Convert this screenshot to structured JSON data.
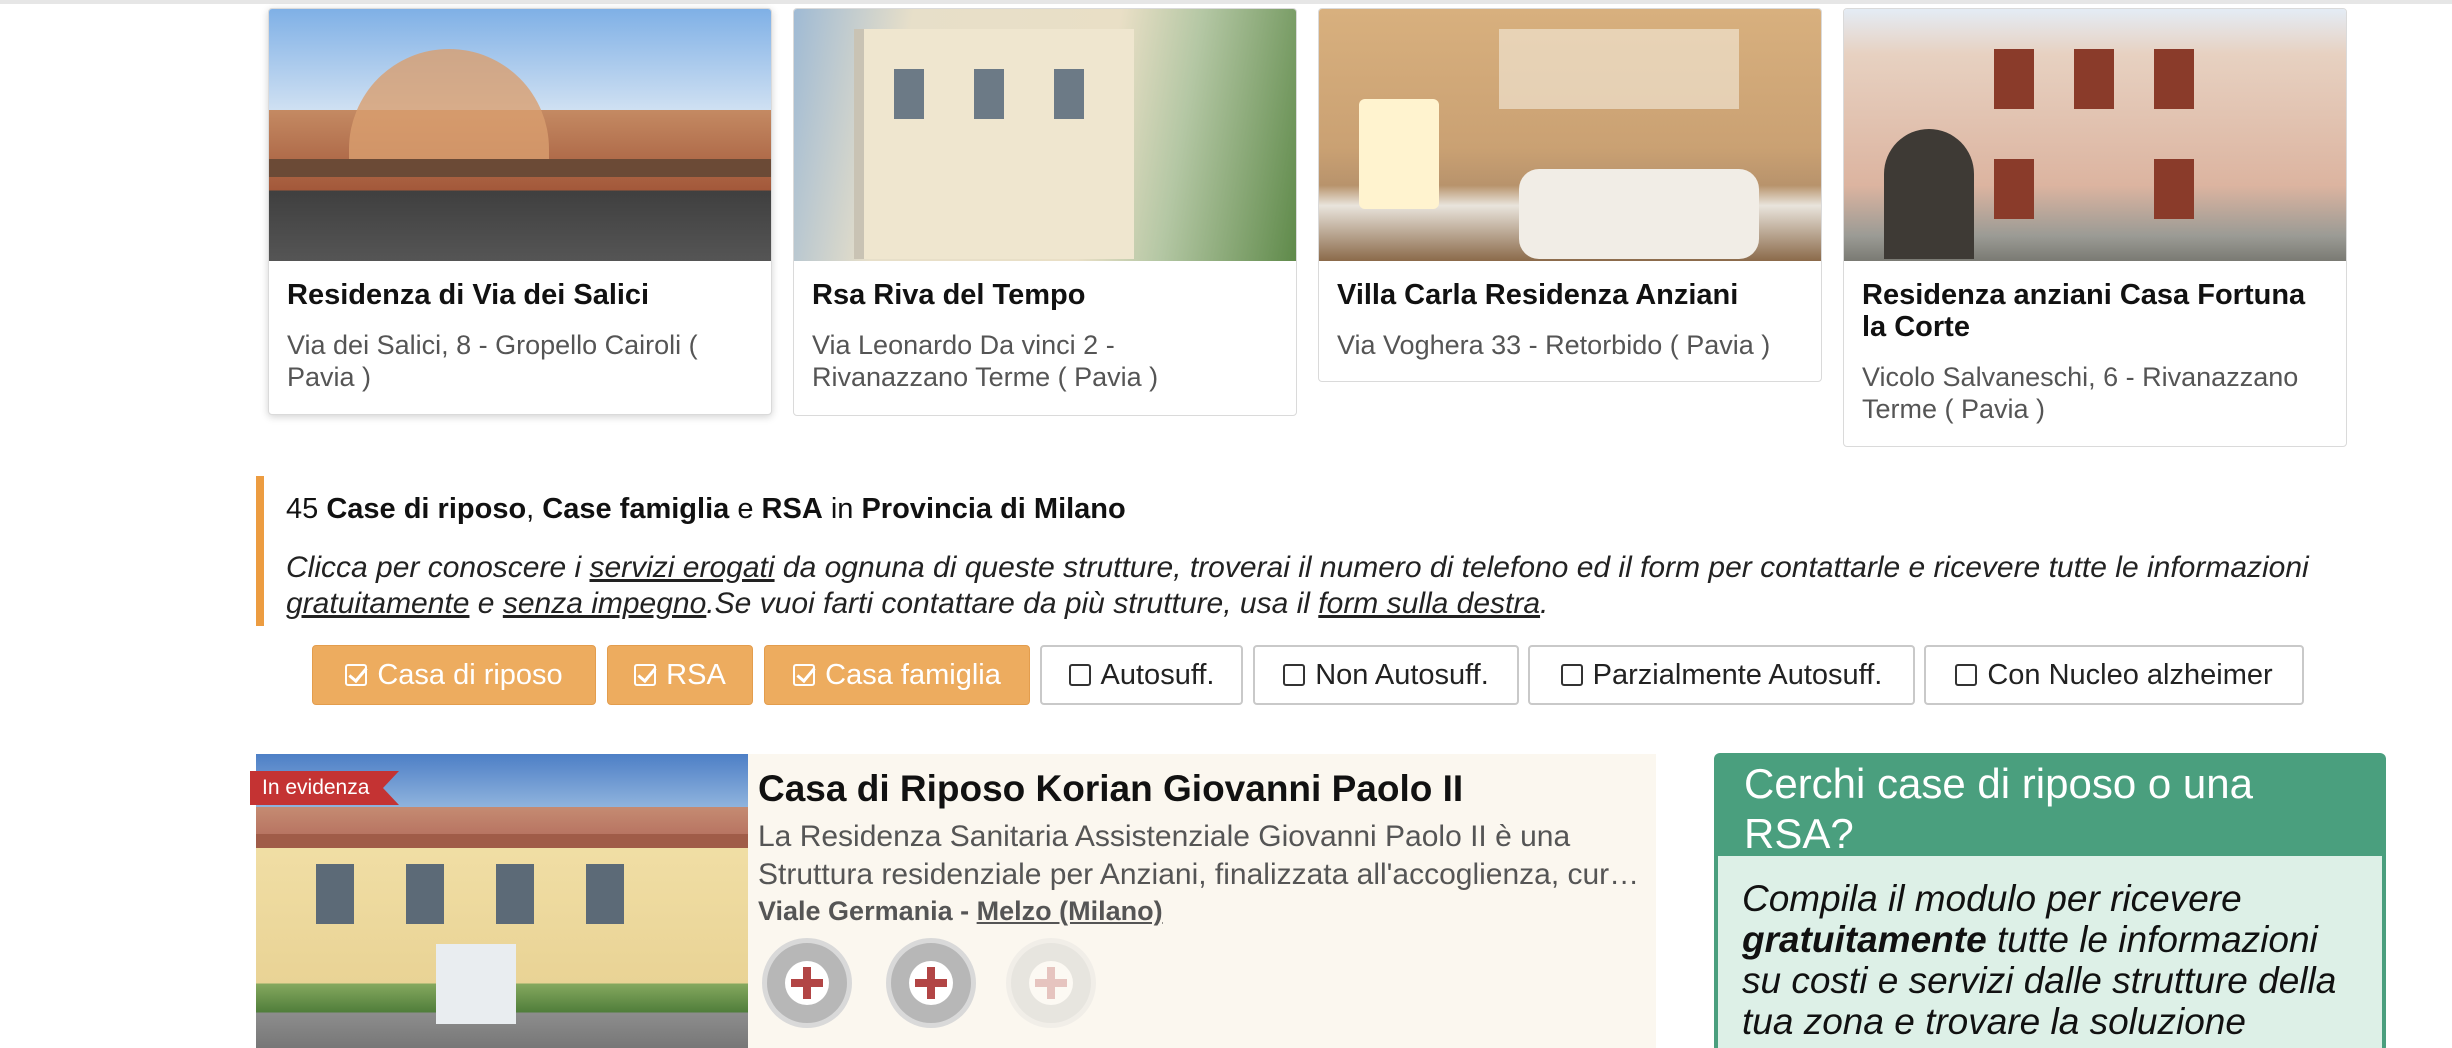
{
  "cards": [
    {
      "title": "Residenza di Via dei Salici",
      "address": "Via dei Salici, 8 - Gropello Cairoli ( Pavia )"
    },
    {
      "title": "Rsa Riva del Tempo",
      "address": "Via Leonardo Da vinci 2 - Rivanazzano Terme ( Pavia )"
    },
    {
      "title": "Villa Carla Residenza Anziani",
      "address": "Via Voghera 33 - Retorbido ( Pavia )"
    },
    {
      "title": "Residenza anziani Casa Fortuna la Corte",
      "address": "Vicolo Salvaneschi, 6 - Rivanazzano Terme ( Pavia )"
    }
  ],
  "heading": {
    "count": "45",
    "t1": "Case di riposo",
    "sep1": ",",
    "t2": "Case famiglia",
    "sep2": "e",
    "t3": "RSA",
    "sep3": "in",
    "t4": "Provincia di Milano"
  },
  "intro": {
    "p1": "Clicca per conoscere i",
    "link1": "servizi erogati",
    "p2": "da ognuna di queste strutture, troverai il numero di telefono ed il form per contattarle e ricevere tutte le informazioni",
    "link2": "gratuitamente",
    "p3": "e",
    "link3": "senza impegno",
    "p4": ".Se vuoi farti contattare da più strutture, usa il",
    "link4": "form sulla destra",
    "p5": "."
  },
  "filters": [
    {
      "label": "Casa di riposo",
      "checked": true
    },
    {
      "label": "RSA",
      "checked": true
    },
    {
      "label": "Casa famiglia",
      "checked": true
    },
    {
      "label": "Autosuff.",
      "checked": false
    },
    {
      "label": "Non Autosuff.",
      "checked": false
    },
    {
      "label": "Parzialmente Autosuff.",
      "checked": false
    },
    {
      "label": "Con Nucleo alzheimer",
      "checked": false
    }
  ],
  "listing": {
    "ribbon": "In evidenza",
    "title": "Casa di Riposo Korian Giovanni Paolo II",
    "desc_line1": "La Residenza Sanitaria Assistenziale Giovanni Paolo II è una",
    "desc_line2": "Struttura residenziale per Anziani, finalizzata all'accoglienza, cur…",
    "street": "Viale Germania -",
    "city": "Melzo (Milano)"
  },
  "sidebar": {
    "title": "Cerchi case di riposo o una RSA?",
    "text1": "Compila il modulo per ricevere",
    "bold": "gratuitamente",
    "text2": "tutte le informazioni su costi e servizi dalle strutture della tua zona e trovare la soluzione"
  },
  "colors": {
    "accent": "#ec9c41",
    "filter_on": "#edac5f",
    "ribbon": "#c43333",
    "sidebar_green": "#4a9f7e",
    "sidebar_light": "#ddf0e7",
    "listing_bg": "#fbf7ef"
  }
}
